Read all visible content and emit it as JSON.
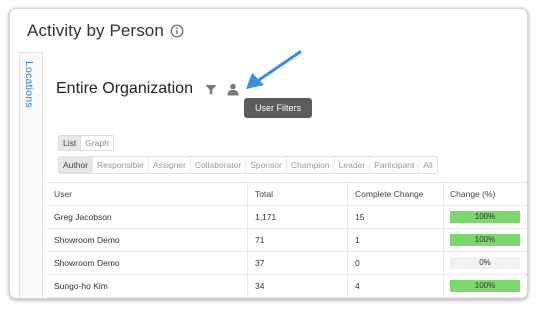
{
  "page": {
    "title": "Activity by Person",
    "side_tab": "Locations",
    "org_title": "Entire Organization",
    "tooltip": "User Filters"
  },
  "icons": {
    "info": "info-circle-icon",
    "filter": "filter-funnel-icon",
    "user": "person-icon",
    "arrow": "pointer-arrow-icon"
  },
  "colors": {
    "accent": "#2a7cc7",
    "arrow": "#3a8fdc",
    "bar_fill": "#7ed66e",
    "tooltip_bg": "#5c5c5c"
  },
  "view_toggle": [
    {
      "label": "List",
      "active": true
    },
    {
      "label": "Graph",
      "active": false
    }
  ],
  "role_tabs": [
    {
      "label": "Author",
      "active": true
    },
    {
      "label": "Responsible",
      "active": false
    },
    {
      "label": "Assigner",
      "active": false
    },
    {
      "label": "Collaborator",
      "active": false
    },
    {
      "label": "Sponsor",
      "active": false
    },
    {
      "label": "Champion",
      "active": false
    },
    {
      "label": "Leader",
      "active": false
    },
    {
      "label": "Participant",
      "active": false
    },
    {
      "label": "All",
      "active": false
    }
  ],
  "table": {
    "columns": [
      "User",
      "Total",
      "Complete Change",
      "Change (%)"
    ],
    "rows": [
      {
        "user": "Greg Jacobson",
        "total": "1,171",
        "complete_change": "15",
        "change_pct": "100%",
        "change_value": 100
      },
      {
        "user": "Showroom Demo",
        "total": "71",
        "complete_change": "1",
        "change_pct": "100%",
        "change_value": 100
      },
      {
        "user": "Showroom Demo",
        "total": "37",
        "complete_change": "0",
        "change_pct": "0%",
        "change_value": 0
      },
      {
        "user": "Sungo-ho Kim",
        "total": "34",
        "complete_change": "4",
        "change_pct": "100%",
        "change_value": 100
      }
    ]
  }
}
